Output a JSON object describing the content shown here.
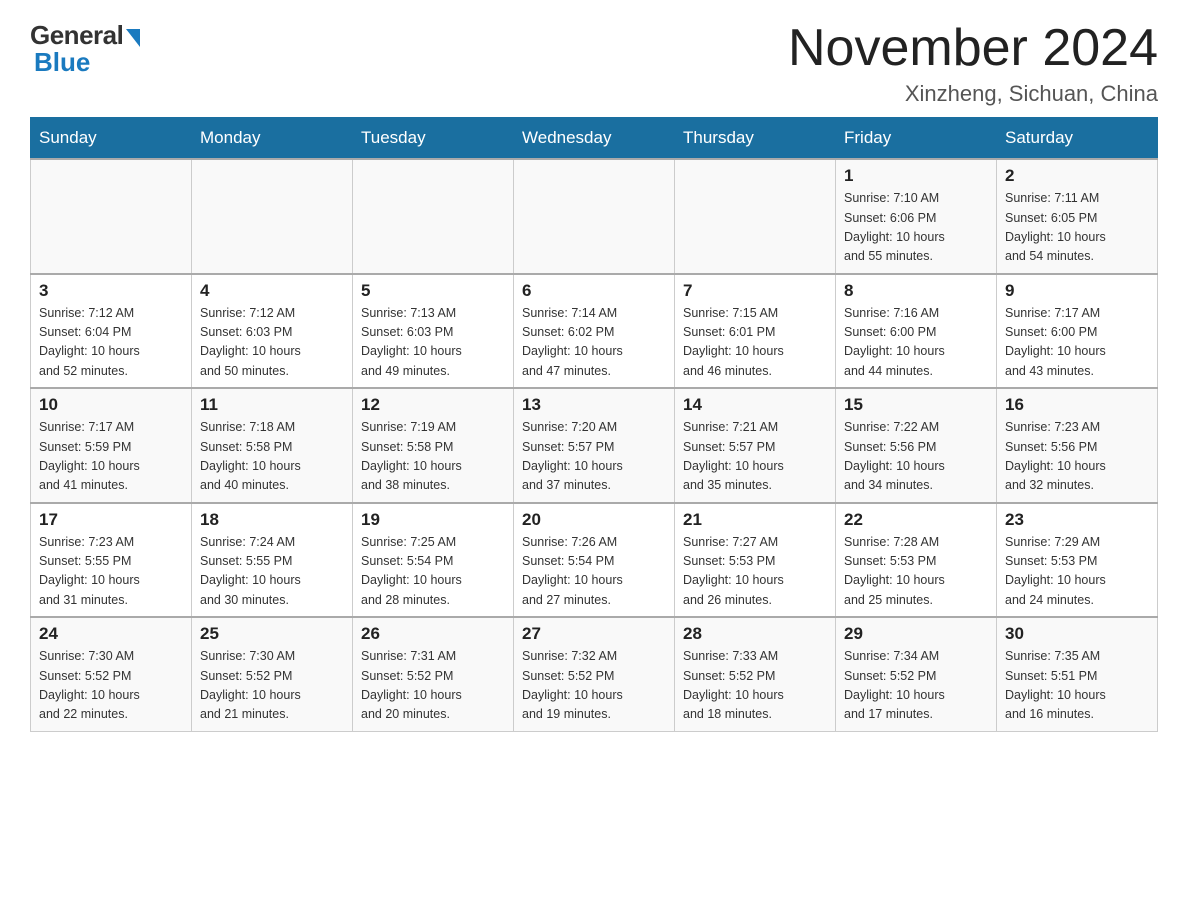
{
  "logo": {
    "general": "General",
    "blue": "Blue",
    "subtitle": "Blue"
  },
  "title": {
    "month_year": "November 2024",
    "location": "Xinzheng, Sichuan, China"
  },
  "headers": [
    "Sunday",
    "Monday",
    "Tuesday",
    "Wednesday",
    "Thursday",
    "Friday",
    "Saturday"
  ],
  "weeks": [
    [
      {
        "day": "",
        "info": ""
      },
      {
        "day": "",
        "info": ""
      },
      {
        "day": "",
        "info": ""
      },
      {
        "day": "",
        "info": ""
      },
      {
        "day": "",
        "info": ""
      },
      {
        "day": "1",
        "info": "Sunrise: 7:10 AM\nSunset: 6:06 PM\nDaylight: 10 hours\nand 55 minutes."
      },
      {
        "day": "2",
        "info": "Sunrise: 7:11 AM\nSunset: 6:05 PM\nDaylight: 10 hours\nand 54 minutes."
      }
    ],
    [
      {
        "day": "3",
        "info": "Sunrise: 7:12 AM\nSunset: 6:04 PM\nDaylight: 10 hours\nand 52 minutes."
      },
      {
        "day": "4",
        "info": "Sunrise: 7:12 AM\nSunset: 6:03 PM\nDaylight: 10 hours\nand 50 minutes."
      },
      {
        "day": "5",
        "info": "Sunrise: 7:13 AM\nSunset: 6:03 PM\nDaylight: 10 hours\nand 49 minutes."
      },
      {
        "day": "6",
        "info": "Sunrise: 7:14 AM\nSunset: 6:02 PM\nDaylight: 10 hours\nand 47 minutes."
      },
      {
        "day": "7",
        "info": "Sunrise: 7:15 AM\nSunset: 6:01 PM\nDaylight: 10 hours\nand 46 minutes."
      },
      {
        "day": "8",
        "info": "Sunrise: 7:16 AM\nSunset: 6:00 PM\nDaylight: 10 hours\nand 44 minutes."
      },
      {
        "day": "9",
        "info": "Sunrise: 7:17 AM\nSunset: 6:00 PM\nDaylight: 10 hours\nand 43 minutes."
      }
    ],
    [
      {
        "day": "10",
        "info": "Sunrise: 7:17 AM\nSunset: 5:59 PM\nDaylight: 10 hours\nand 41 minutes."
      },
      {
        "day": "11",
        "info": "Sunrise: 7:18 AM\nSunset: 5:58 PM\nDaylight: 10 hours\nand 40 minutes."
      },
      {
        "day": "12",
        "info": "Sunrise: 7:19 AM\nSunset: 5:58 PM\nDaylight: 10 hours\nand 38 minutes."
      },
      {
        "day": "13",
        "info": "Sunrise: 7:20 AM\nSunset: 5:57 PM\nDaylight: 10 hours\nand 37 minutes."
      },
      {
        "day": "14",
        "info": "Sunrise: 7:21 AM\nSunset: 5:57 PM\nDaylight: 10 hours\nand 35 minutes."
      },
      {
        "day": "15",
        "info": "Sunrise: 7:22 AM\nSunset: 5:56 PM\nDaylight: 10 hours\nand 34 minutes."
      },
      {
        "day": "16",
        "info": "Sunrise: 7:23 AM\nSunset: 5:56 PM\nDaylight: 10 hours\nand 32 minutes."
      }
    ],
    [
      {
        "day": "17",
        "info": "Sunrise: 7:23 AM\nSunset: 5:55 PM\nDaylight: 10 hours\nand 31 minutes."
      },
      {
        "day": "18",
        "info": "Sunrise: 7:24 AM\nSunset: 5:55 PM\nDaylight: 10 hours\nand 30 minutes."
      },
      {
        "day": "19",
        "info": "Sunrise: 7:25 AM\nSunset: 5:54 PM\nDaylight: 10 hours\nand 28 minutes."
      },
      {
        "day": "20",
        "info": "Sunrise: 7:26 AM\nSunset: 5:54 PM\nDaylight: 10 hours\nand 27 minutes."
      },
      {
        "day": "21",
        "info": "Sunrise: 7:27 AM\nSunset: 5:53 PM\nDaylight: 10 hours\nand 26 minutes."
      },
      {
        "day": "22",
        "info": "Sunrise: 7:28 AM\nSunset: 5:53 PM\nDaylight: 10 hours\nand 25 minutes."
      },
      {
        "day": "23",
        "info": "Sunrise: 7:29 AM\nSunset: 5:53 PM\nDaylight: 10 hours\nand 24 minutes."
      }
    ],
    [
      {
        "day": "24",
        "info": "Sunrise: 7:30 AM\nSunset: 5:52 PM\nDaylight: 10 hours\nand 22 minutes."
      },
      {
        "day": "25",
        "info": "Sunrise: 7:30 AM\nSunset: 5:52 PM\nDaylight: 10 hours\nand 21 minutes."
      },
      {
        "day": "26",
        "info": "Sunrise: 7:31 AM\nSunset: 5:52 PM\nDaylight: 10 hours\nand 20 minutes."
      },
      {
        "day": "27",
        "info": "Sunrise: 7:32 AM\nSunset: 5:52 PM\nDaylight: 10 hours\nand 19 minutes."
      },
      {
        "day": "28",
        "info": "Sunrise: 7:33 AM\nSunset: 5:52 PM\nDaylight: 10 hours\nand 18 minutes."
      },
      {
        "day": "29",
        "info": "Sunrise: 7:34 AM\nSunset: 5:52 PM\nDaylight: 10 hours\nand 17 minutes."
      },
      {
        "day": "30",
        "info": "Sunrise: 7:35 AM\nSunset: 5:51 PM\nDaylight: 10 hours\nand 16 minutes."
      }
    ]
  ]
}
